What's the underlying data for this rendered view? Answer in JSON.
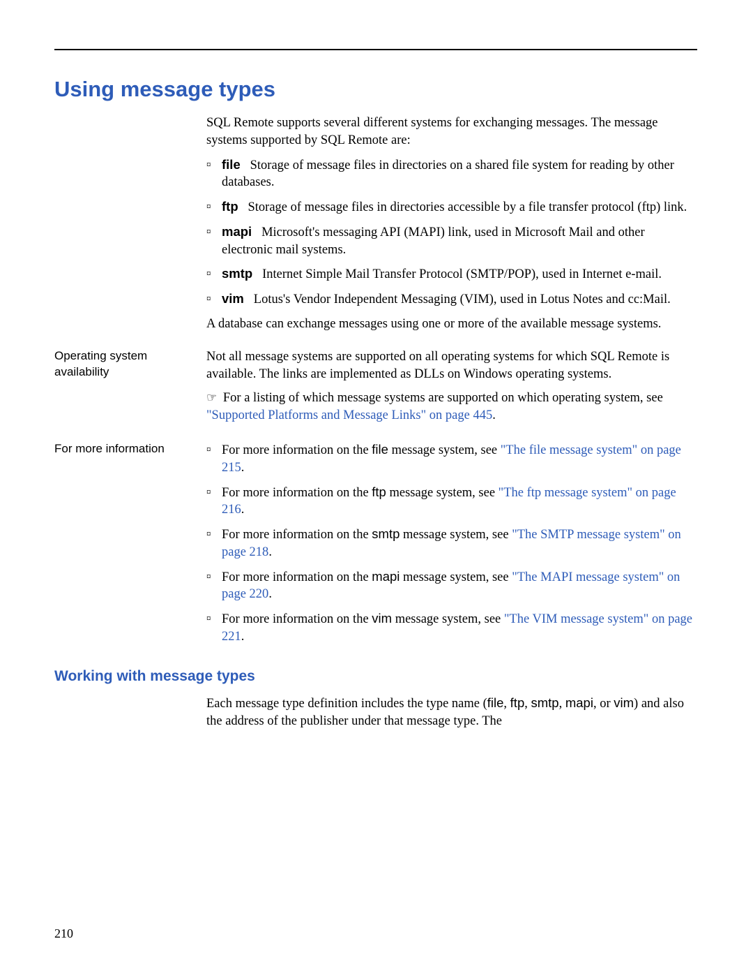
{
  "page_number": "210",
  "heading": "Using message types",
  "intro": "SQL Remote supports several different systems for exchanging messages. The message systems supported by SQL Remote are:",
  "message_types": [
    {
      "name": "file",
      "desc": "Storage of message files in directories on a shared file system for reading by other databases."
    },
    {
      "name": "ftp",
      "desc": "Storage of message files in directories accessible by a file transfer protocol (ftp) link."
    },
    {
      "name": "mapi",
      "desc": "Microsoft's messaging API (MAPI) link, used in Microsoft Mail and other electronic mail systems."
    },
    {
      "name": "smtp",
      "desc": "Internet Simple Mail Transfer Protocol (SMTP/POP), used in Internet e-mail."
    },
    {
      "name": "vim",
      "desc": "Lotus's Vendor Independent Messaging (VIM), used in Lotus Notes and cc:Mail."
    }
  ],
  "after_types": "A database can exchange messages using one or more of the available message systems.",
  "os_avail": {
    "label": "Operating system availability",
    "text": "Not all message systems are supported on all operating systems for which SQL Remote is available. The links are implemented as DLLs on Windows operating systems."
  },
  "note": {
    "prefix": "For a listing of which message systems are supported on which operating system, see ",
    "xref": "\"Supported Platforms and Message Links\" on page 445",
    "suffix": "."
  },
  "more_info": {
    "label": "For more information",
    "items": [
      {
        "prefix": "For more information on the ",
        "code": "ﬁle",
        "mid": " message system, see ",
        "xref": "\"The file message system\" on page 215",
        "suffix": "."
      },
      {
        "prefix": "For more information on the ",
        "code": "ftp",
        "mid": " message system, see ",
        "xref": "\"The ftp message system\" on page 216",
        "suffix": "."
      },
      {
        "prefix": "For more information on the ",
        "code": "smtp",
        "mid": " message system, see ",
        "xref": "\"The SMTP message system\" on page 218",
        "suffix": "."
      },
      {
        "prefix": "For more information on the ",
        "code": "mapi",
        "mid": " message system, see ",
        "xref": "\"The MAPI message system\" on page 220",
        "suffix": "."
      },
      {
        "prefix": "For more information on the ",
        "code": "vim",
        "mid": " message system, see ",
        "xref": "\"The VIM message system\" on page 221",
        "suffix": "."
      }
    ]
  },
  "subheading": "Working with message types",
  "type_names": {
    "n1": "ﬁle",
    "n2": "ftp",
    "n3": "smtp",
    "n4": "mapi",
    "n5": "vim"
  },
  "working_text_p1": "Each message type definition includes the type name (",
  "working_text_p2": ", or ",
  "working_text_p3": ") and also the address of the publisher under that message type. The",
  "comma_sep": ", "
}
